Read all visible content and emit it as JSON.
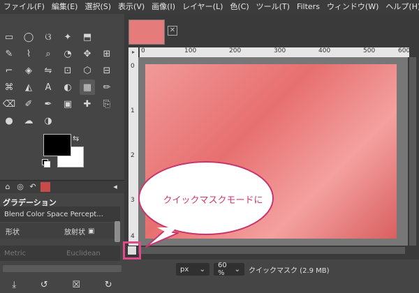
{
  "menubar": {
    "items": [
      "ファイル(F)",
      "編集(E)",
      "選択(S)",
      "表示(V)",
      "画像(I)",
      "レイヤー(L)",
      "色(C)",
      "ツール(T)",
      "Filters",
      "ウィンドウ(W)",
      "ヘルプ(H)"
    ]
  },
  "toolbox": {
    "icons": [
      "rect-select",
      "ellipse-select",
      "free-select",
      "fuzzy-select",
      "extra-select",
      "color-picker",
      "zoom",
      "measure",
      "move",
      "alignment",
      "crop",
      "flip",
      "unified-transform",
      "warp",
      "handle-transform",
      "cage",
      "perspective",
      "text",
      "paint",
      "gradient",
      "pencil",
      "paintbrush",
      "eraser",
      "airbrush",
      "ink",
      "mybrush",
      "heal",
      "clone",
      "blur",
      "dodge",
      "smudge",
      "path"
    ]
  },
  "tool_options": {
    "title": "グラデーション",
    "blend": "Blend Color Space Percept...",
    "shape_label": "形状",
    "shape_value": "放射状",
    "metric_label": "Metric",
    "metric_value": "Euclidean"
  },
  "rulers": {
    "h_ticks": [
      "0",
      "100",
      "200",
      "300",
      "400",
      "500",
      "600"
    ],
    "v_ticks": [
      "0",
      "1",
      "2",
      "3",
      "4"
    ]
  },
  "status": {
    "unit": "px",
    "zoom": "60 %",
    "message": "クイックマスク (2.9 MB)"
  },
  "bubble": {
    "text": "クイックマスクモードに"
  },
  "colors": {
    "accent": "#e04a8a",
    "mask": "#e57b7b"
  }
}
